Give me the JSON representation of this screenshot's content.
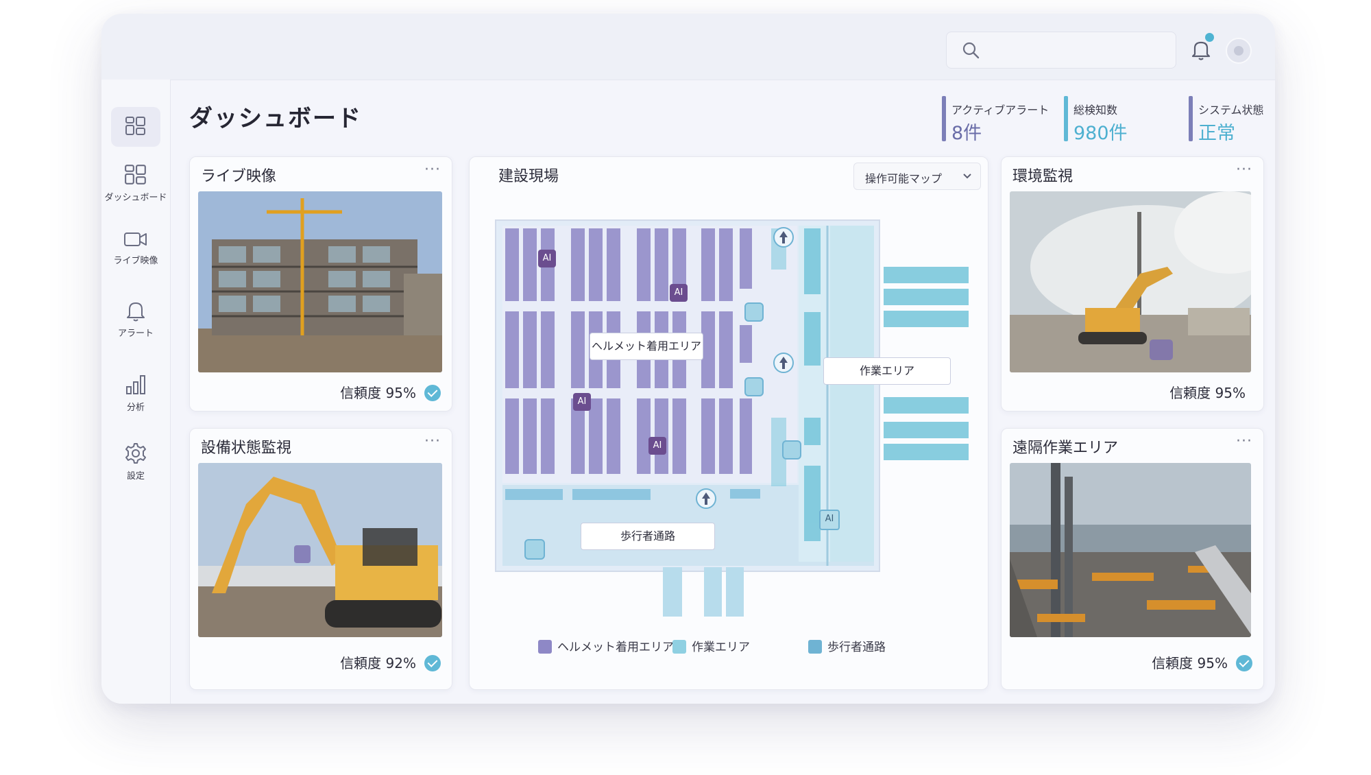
{
  "colors": {
    "accent_purple": "#7c7fb8",
    "accent_cyan": "#5fb8d6",
    "helmet_zone": "#8e88c6",
    "work_zone": "#8fd0e2",
    "pedestrian": "#6fb3d3",
    "ai_badge": "#6b4d8f"
  },
  "topbar": {
    "search_icon": "search-icon",
    "bell_icon": "bell-icon"
  },
  "sidebar": {
    "items": [
      {
        "label": "ダッシュボード",
        "icon": "dashboard-icon"
      },
      {
        "label": "ライブ映像",
        "icon": "video-camera-icon"
      },
      {
        "label": "アラート",
        "icon": "alert-bell-icon"
      },
      {
        "label": "分析",
        "icon": "bar-chart-icon"
      },
      {
        "label": "設定",
        "icon": "gear-icon"
      }
    ]
  },
  "header": {
    "title": "ダッシュボード",
    "stats": [
      {
        "label": "アクティブアラート",
        "value": "8件"
      },
      {
        "label": "総検知数",
        "value": "980件"
      },
      {
        "label": "システム状態",
        "value": "正常"
      }
    ]
  },
  "cards": {
    "live_video": {
      "title": "ライブ映像",
      "more": "···",
      "confidence_label": "信頼度",
      "confidence": "95%"
    },
    "equipment": {
      "title": "設備状態監視",
      "more": "···",
      "confidence_label": "信頼度",
      "confidence": "92%"
    },
    "environment": {
      "title": "環境監視",
      "more": "···",
      "confidence_label": "信頼度",
      "confidence": "95%"
    },
    "remote": {
      "title": "遠隔作業エリア",
      "more": "···",
      "confidence_label": "信頼度",
      "confidence": "95%"
    }
  },
  "map": {
    "title": "建設現場",
    "dropdown": "操作可能マップ",
    "labels": {
      "helmet_area": "ヘルメット着用エリア",
      "work_area": "作業エリア",
      "walkway": "歩行者通路"
    },
    "ai_badge": "AI",
    "legend": [
      {
        "label": "ヘルメット着用エリア",
        "color": "#8e88c6"
      },
      {
        "label": "作業エリア",
        "color": "#8fd0e2"
      },
      {
        "label": "歩行者通路",
        "color": "#6fb3d3"
      }
    ]
  }
}
